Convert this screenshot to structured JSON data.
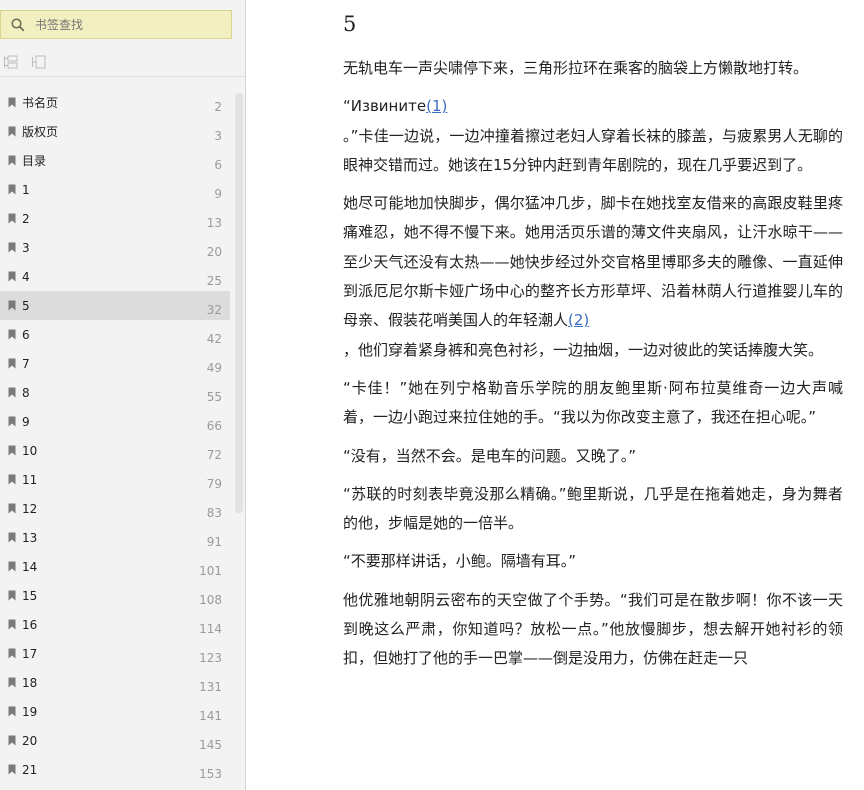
{
  "search": {
    "placeholder": "书签查找"
  },
  "bookmarks": [
    {
      "label": "书名页",
      "page": "2"
    },
    {
      "label": "版权页",
      "page": "3"
    },
    {
      "label": "目录",
      "page": "6"
    },
    {
      "label": "1",
      "page": "9"
    },
    {
      "label": "2",
      "page": "13"
    },
    {
      "label": "3",
      "page": "20"
    },
    {
      "label": "4",
      "page": "25"
    },
    {
      "label": "5",
      "page": "32"
    },
    {
      "label": "6",
      "page": "42"
    },
    {
      "label": "7",
      "page": "49"
    },
    {
      "label": "8",
      "page": "55"
    },
    {
      "label": "9",
      "page": "66"
    },
    {
      "label": "10",
      "page": "72"
    },
    {
      "label": "11",
      "page": "79"
    },
    {
      "label": "12",
      "page": "83"
    },
    {
      "label": "13",
      "page": "91"
    },
    {
      "label": "14",
      "page": "101"
    },
    {
      "label": "15",
      "page": "108"
    },
    {
      "label": "16",
      "page": "114"
    },
    {
      "label": "17",
      "page": "123"
    },
    {
      "label": "18",
      "page": "131"
    },
    {
      "label": "19",
      "page": "141"
    },
    {
      "label": "20",
      "page": "145"
    },
    {
      "label": "21",
      "page": "153"
    }
  ],
  "active_bookmark": "5",
  "content": {
    "chapter_title": "5",
    "p1": "无轨电车一声尖啸停下来，三角形拉环在乘客的脑袋上方懒散地打转。",
    "p2a": "“Извините",
    "p2_note": "(1)",
    "p2b": "。”卡佳一边说，一边冲撞着擦过老妇人穿着长袜的膝盖，与疲累男人无聊的眼神交错而过。她该在15分钟内赶到青年剧院的，现在几乎要迟到了。",
    "p3a": "她尽可能地加快脚步，偶尔猛冲几步，脚卡在她找室友借来的高跟皮鞋里疼痛难忍，她不得不慢下来。她用活页乐谱的薄文件夹扇风，让汗水晾干——至少天气还没有太热——她快步经过外交官格里博耶多夫的雕像、一直延伸到派厄尼尔斯卡娅广场中心的整齐长方形草坪、沿着林荫人行道推婴儿车的母亲、假装花哨美国人的年轻潮人",
    "p3_note": "(2)",
    "p3b": "，他们穿着紧身裤和亮色衬衫，一边抽烟，一边对彼此的笑话捧腹大笑。",
    "p4": "“卡佳！”她在列宁格勒音乐学院的朋友鲍里斯·阿布拉莫维奇一边大声喊着，一边小跑过来拉住她的手。“我以为你改变主意了，我还在担心呢。”",
    "p5": "“没有，当然不会。是电车的问题。又晚了。”",
    "p6": "“苏联的时刻表毕竟没那么精确。”鲍里斯说，几乎是在拖着她走，身为舞者的他，步幅是她的一倍半。",
    "p7": "“不要那样讲话，小鲍。隔墙有耳。”",
    "p8": "他优雅地朝阴云密布的天空做了个手势。“我们可是在散步啊！你不该一天到晚这么严肃，你知道吗？放松一点。”他放慢脚步，想去解开她衬衫的领扣，但她打了他的手一巴掌——倒是没用力，仿佛在赶走一只"
  }
}
